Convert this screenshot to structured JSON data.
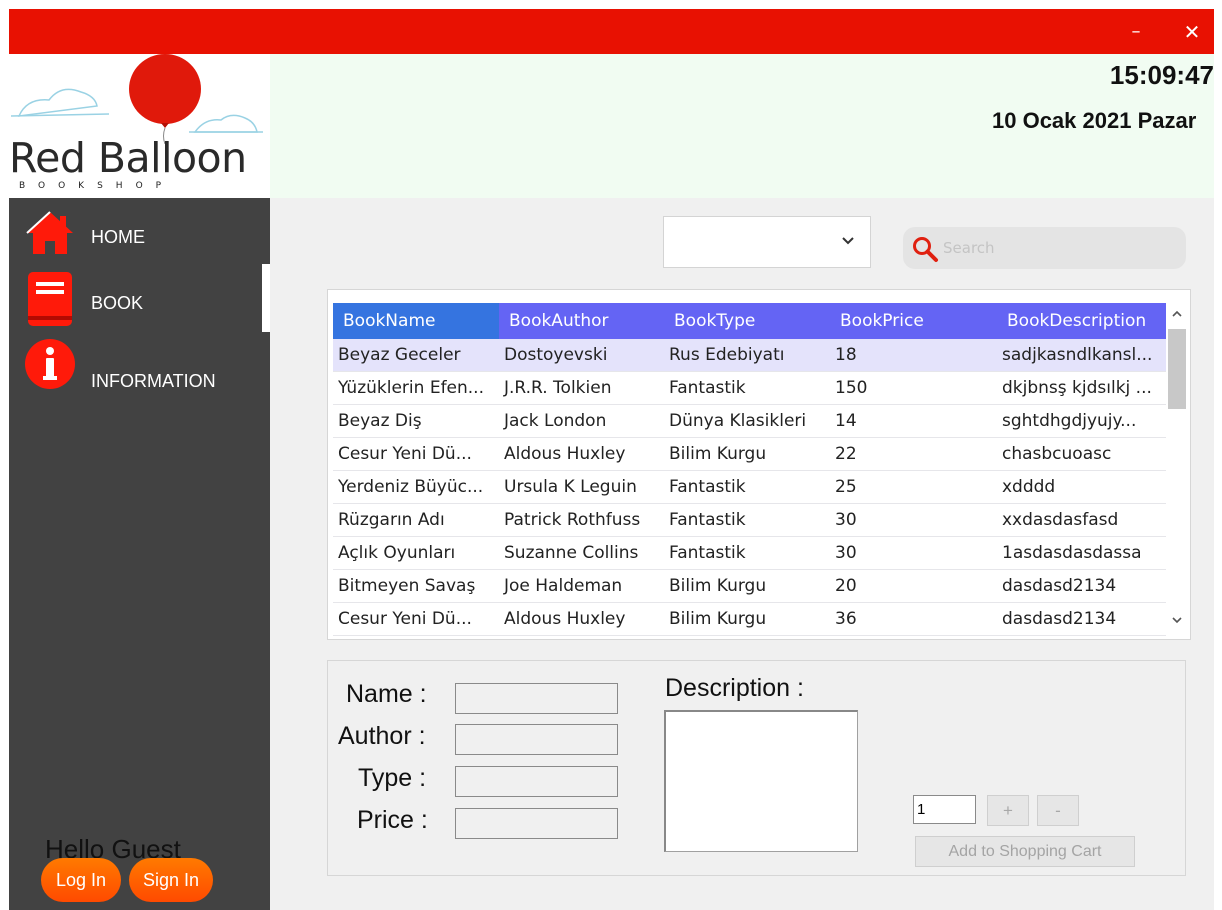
{
  "window": {
    "minimize_glyph": "–",
    "close_glyph": "✕",
    "accent_color": "#e81102"
  },
  "logo": {
    "name": "Red Balloon",
    "subtitle": "BOOKSHOP",
    "balloon_color": "#e0190b"
  },
  "header": {
    "time": "15:09:47",
    "date": "10 Ocak 2021 Pazar"
  },
  "sidebar": {
    "items": [
      {
        "label": "HOME",
        "icon": "house-icon"
      },
      {
        "label": "BOOK",
        "icon": "book-icon"
      },
      {
        "label": "INFORMATION",
        "icon": "info-icon"
      }
    ],
    "active_item": "BOOK",
    "greeting": "Hello Guest",
    "login_label": "Log In",
    "signin_label": "Sign In"
  },
  "filter": {
    "selected": ""
  },
  "search": {
    "placeholder": "Search",
    "value": ""
  },
  "table": {
    "header_color_selected": "#3574e0",
    "header_color": "#6464f4",
    "columns": [
      "BookName",
      "BookAuthor",
      "BookType",
      "BookPrice",
      "BookDescription"
    ],
    "rows": [
      [
        "Beyaz Geceler",
        "Dostoyevski",
        "Rus Edebiyatı",
        "18",
        "sadjkasndlkansl..."
      ],
      [
        "Yüzüklerin Efen...",
        "J.R.R. Tolkien",
        "Fantastik",
        "150",
        "dkjbnsş kjdsılkj ..."
      ],
      [
        "Beyaz Diş",
        "Jack London",
        "Dünya Klasikleri",
        "14",
        "sghtdhgdjyujy..."
      ],
      [
        "Cesur Yeni Dü...",
        "Aldous Huxley",
        "Bilim Kurgu",
        "22",
        "chasbcuoasc"
      ],
      [
        "Yerdeniz Büyüc...",
        "Ursula K Leguin",
        "Fantastik",
        "25",
        "xdddd"
      ],
      [
        "Rüzgarın Adı",
        "Patrick Rothfuss",
        "Fantastik",
        "30",
        "xxdasdasfasd"
      ],
      [
        "Açlık Oyunları",
        "Suzanne Collins",
        "Fantastik",
        "30",
        "1asdasdasdassa"
      ],
      [
        "Bitmeyen Savaş",
        "Joe Haldeman",
        "Bilim Kurgu",
        "20",
        "dasdasd2134"
      ],
      [
        "Cesur Yeni Dü...",
        "Aldous Huxley",
        "Bilim Kurgu",
        "36",
        "dasdasd2134"
      ]
    ],
    "selected_row": 0
  },
  "details": {
    "name_label": "Name :",
    "author_label": "Author :",
    "type_label": "Type :",
    "price_label": "Price :",
    "description_label": "Description :",
    "name_value": "",
    "author_value": "",
    "type_value": "",
    "price_value": "",
    "description_value": "",
    "quantity": "1",
    "plus_label": "+",
    "minus_label": "-",
    "add_to_cart_label": "Add to Shopping Cart"
  }
}
